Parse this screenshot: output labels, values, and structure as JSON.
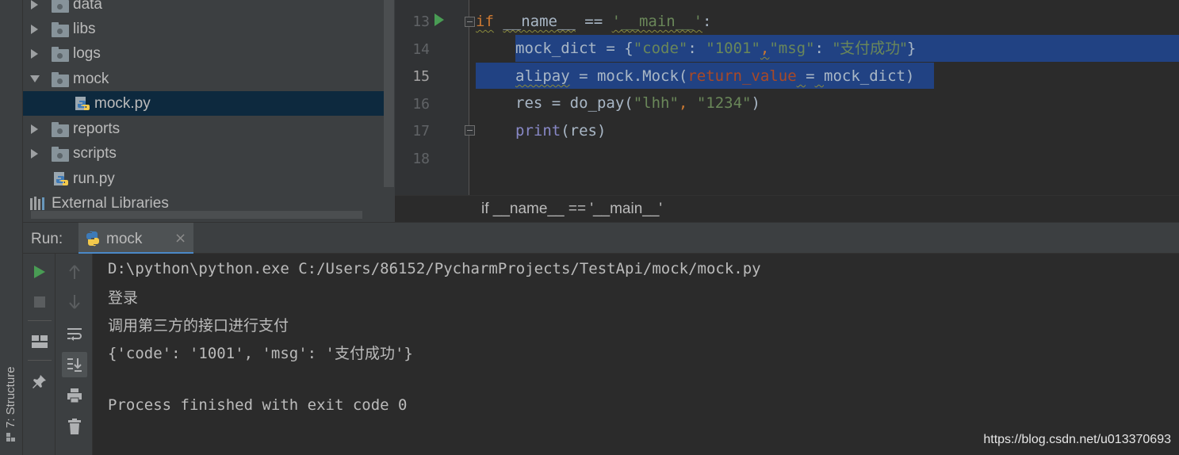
{
  "project_tree": {
    "items": [
      {
        "label": "data",
        "kind": "folder",
        "expanded": false
      },
      {
        "label": "libs",
        "kind": "folder",
        "expanded": false
      },
      {
        "label": "logs",
        "kind": "folder",
        "expanded": false
      },
      {
        "label": "mock",
        "kind": "folder",
        "expanded": true
      },
      {
        "label": "mock.py",
        "kind": "python-file",
        "selected": true
      },
      {
        "label": "reports",
        "kind": "folder",
        "expanded": false
      },
      {
        "label": "scripts",
        "kind": "folder",
        "expanded": false
      },
      {
        "label": "run.py",
        "kind": "python-file"
      },
      {
        "label": "External Libraries",
        "kind": "library"
      }
    ]
  },
  "editor": {
    "line_numbers": [
      "13",
      "14",
      "15",
      "16",
      "17",
      "18"
    ],
    "current_line": "15",
    "code": {
      "l13_if": "if",
      "l13_name": "__name__",
      "l13_eq": " == ",
      "l13_main": "'__main__'",
      "l13_colon": ":",
      "l14_var": "mock_dict = {",
      "l14_k1": "\"code\"",
      "l14_c1": ": ",
      "l14_v1": "\"1001\"",
      "l14_comma": ",",
      "l14_k2": "\"msg\"",
      "l14_c2": ": ",
      "l14_v2": "\"支付成功\"",
      "l14_end": "}",
      "l15_var": "alipay",
      "l15_mid": " = mock.Mock(",
      "l15_param": "return_value",
      "l15_sp": " ",
      "l15_eq": "=",
      "l15_sp2": " ",
      "l15_arg": "mock_dict",
      "l15_end": ")",
      "l16_a": "res = do_pay(",
      "l16_s1": "\"lhh\"",
      "l16_comma": ", ",
      "l16_s2": "\"1234\"",
      "l16_end": ")",
      "l17_print": "print",
      "l17_rest": "(res)"
    }
  },
  "breadcrumb": "if __name__ == '__main__'",
  "run_window": {
    "label": "Run:",
    "tab_label": "mock",
    "close_glyph": "×",
    "console": [
      "D:\\python\\python.exe C:/Users/86152/PycharmProjects/TestApi/mock/mock.py",
      "登录",
      "调用第三方的接口进行支付",
      "{'code': '1001', 'msg': '支付成功'}",
      "",
      "Process finished with exit code 0"
    ]
  },
  "structure_tab": "7: Structure",
  "watermark": "https://blog.csdn.net/u013370693",
  "colors": {
    "selection": "#214283",
    "keyword": "#cc7832",
    "string": "#6a8759",
    "param": "#aa4926",
    "builtin": "#8888c6",
    "run_green": "#499c54"
  }
}
